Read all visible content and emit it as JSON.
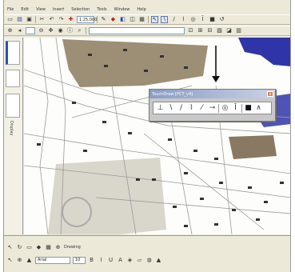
{
  "menu": [
    "File",
    "Edit",
    "View",
    "Insert",
    "Selection",
    "Tools",
    "Window",
    "Help"
  ],
  "toolbar": {
    "scale_value": "1:25,000",
    "combo_small": "",
    "layer_value": ""
  },
  "toc": {
    "tab_label": "Display"
  },
  "draw_toolbar": {
    "title": "TouchDraw [PCT_v4]",
    "close": "x"
  },
  "status": {
    "drawing_label": "Drawing",
    "font_value": "Arial",
    "size_value": "10"
  },
  "colors": {
    "pointer": "#111111",
    "water": "#2f35a8",
    "land_parcel": "#8c7b5e",
    "street": "#888888",
    "pale_area": "#d9d6cc"
  },
  "icons": [
    "zoom-in-icon",
    "zoom-out-icon",
    "pan-icon",
    "identify-icon",
    "select-arrow-icon",
    "polyline-icon",
    "curve-icon",
    "circle-icon",
    "text-icon",
    "fill-icon"
  ]
}
